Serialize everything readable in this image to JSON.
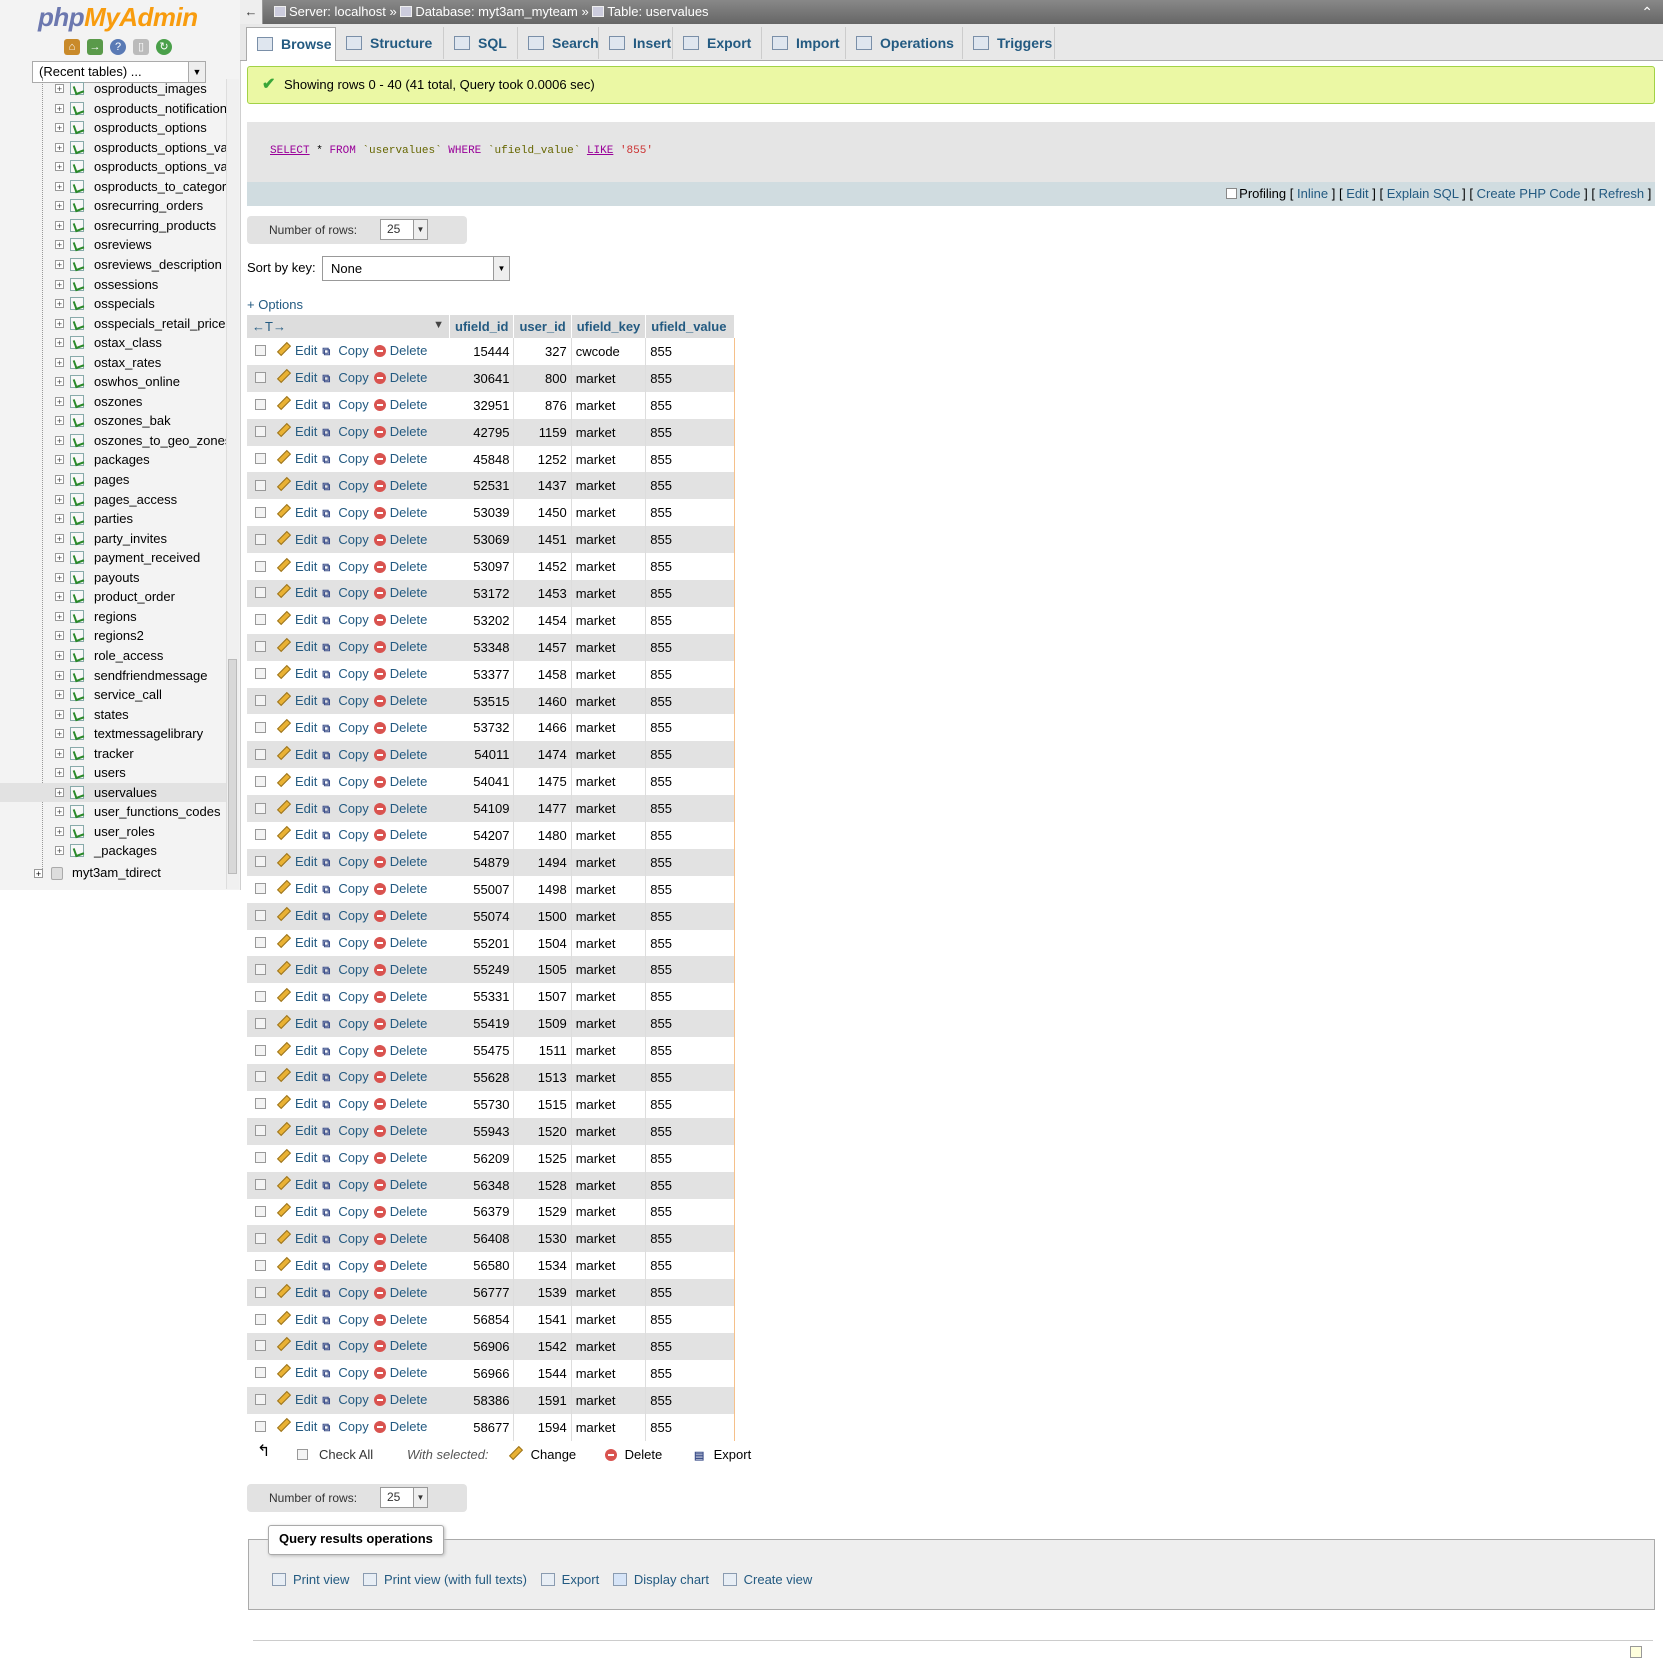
{
  "logo": {
    "php": "php",
    "myadmin": "MyAdmin"
  },
  "nav_icons": [
    "home-icon",
    "logout-icon",
    "help-icon",
    "docs-icon",
    "reload-icon"
  ],
  "recent_tables": {
    "value": "(Recent tables) ..."
  },
  "tree": {
    "tables": [
      "osproducts_images",
      "osproducts_notifications",
      "osproducts_options",
      "osproducts_options_values",
      "osproducts_options_values_to",
      "osproducts_to_categories",
      "osrecurring_orders",
      "osrecurring_products",
      "osreviews",
      "osreviews_description",
      "ossessions",
      "osspecials",
      "osspecials_retail_prices",
      "ostax_class",
      "ostax_rates",
      "oswhos_online",
      "oszones",
      "oszones_bak",
      "oszones_to_geo_zones",
      "packages",
      "pages",
      "pages_access",
      "parties",
      "party_invites",
      "payment_received",
      "payouts",
      "product_order",
      "regions",
      "regions2",
      "role_access",
      "sendfriendmessage",
      "service_call",
      "states",
      "textmessagelibrary",
      "tracker",
      "users",
      "uservalues",
      "user_functions_codes",
      "user_roles",
      "_packages"
    ],
    "selected": "uservalues",
    "database": "myt3am_tdirect"
  },
  "breadcrumb": {
    "server": "Server: localhost",
    "sep": "»",
    "database": "Database: myt3am_myteam",
    "table": "Table: uservalues"
  },
  "tabs": [
    "Browse",
    "Structure",
    "SQL",
    "Search",
    "Insert",
    "Export",
    "Import",
    "Operations",
    "Triggers"
  ],
  "active_tab": "Browse",
  "message": "Showing rows 0 - 40 (41 total, Query took 0.0006 sec)",
  "sql": {
    "select": "SELECT",
    "star": "*",
    "from": "FROM",
    "table": "`uservalues`",
    "where": "WHERE",
    "column": "`ufield_value`",
    "like": "LIKE",
    "value": "'855'"
  },
  "sql_links": {
    "profiling": "Profiling",
    "inline": "Inline",
    "edit": "Edit",
    "explain": "Explain SQL",
    "php": "Create PHP Code",
    "refresh": "Refresh",
    "lb": "[",
    "rb": "]"
  },
  "number_of_rows": {
    "label": "Number of rows:",
    "value": "25"
  },
  "sort_by": {
    "label": "Sort by key:",
    "value": "None"
  },
  "options_link": "+ Options",
  "columns": {
    "arrows": "←T→",
    "c1": "ufield_id",
    "c2": "user_id",
    "c3": "ufield_key",
    "c4": "ufield_value"
  },
  "row_actions": {
    "edit": "Edit",
    "copy": "Copy",
    "delete": "Delete"
  },
  "rows": [
    [
      "15444",
      "327",
      "cwcode",
      "855"
    ],
    [
      "30641",
      "800",
      "market",
      "855"
    ],
    [
      "32951",
      "876",
      "market",
      "855"
    ],
    [
      "42795",
      "1159",
      "market",
      "855"
    ],
    [
      "45848",
      "1252",
      "market",
      "855"
    ],
    [
      "52531",
      "1437",
      "market",
      "855"
    ],
    [
      "53039",
      "1450",
      "market",
      "855"
    ],
    [
      "53069",
      "1451",
      "market",
      "855"
    ],
    [
      "53097",
      "1452",
      "market",
      "855"
    ],
    [
      "53172",
      "1453",
      "market",
      "855"
    ],
    [
      "53202",
      "1454",
      "market",
      "855"
    ],
    [
      "53348",
      "1457",
      "market",
      "855"
    ],
    [
      "53377",
      "1458",
      "market",
      "855"
    ],
    [
      "53515",
      "1460",
      "market",
      "855"
    ],
    [
      "53732",
      "1466",
      "market",
      "855"
    ],
    [
      "54011",
      "1474",
      "market",
      "855"
    ],
    [
      "54041",
      "1475",
      "market",
      "855"
    ],
    [
      "54109",
      "1477",
      "market",
      "855"
    ],
    [
      "54207",
      "1480",
      "market",
      "855"
    ],
    [
      "54879",
      "1494",
      "market",
      "855"
    ],
    [
      "55007",
      "1498",
      "market",
      "855"
    ],
    [
      "55074",
      "1500",
      "market",
      "855"
    ],
    [
      "55201",
      "1504",
      "market",
      "855"
    ],
    [
      "55249",
      "1505",
      "market",
      "855"
    ],
    [
      "55331",
      "1507",
      "market",
      "855"
    ],
    [
      "55419",
      "1509",
      "market",
      "855"
    ],
    [
      "55475",
      "1511",
      "market",
      "855"
    ],
    [
      "55628",
      "1513",
      "market",
      "855"
    ],
    [
      "55730",
      "1515",
      "market",
      "855"
    ],
    [
      "55943",
      "1520",
      "market",
      "855"
    ],
    [
      "56209",
      "1525",
      "market",
      "855"
    ],
    [
      "56348",
      "1528",
      "market",
      "855"
    ],
    [
      "56379",
      "1529",
      "market",
      "855"
    ],
    [
      "56408",
      "1530",
      "market",
      "855"
    ],
    [
      "56580",
      "1534",
      "market",
      "855"
    ],
    [
      "56777",
      "1539",
      "market",
      "855"
    ],
    [
      "56854",
      "1541",
      "market",
      "855"
    ],
    [
      "56906",
      "1542",
      "market",
      "855"
    ],
    [
      "56966",
      "1544",
      "market",
      "855"
    ],
    [
      "58386",
      "1591",
      "market",
      "855"
    ],
    [
      "58677",
      "1594",
      "market",
      "855"
    ]
  ],
  "bulk": {
    "check_all": "Check All",
    "with_selected": "With selected:",
    "change": "Change",
    "delete": "Delete",
    "export": "Export"
  },
  "qro": {
    "legend": "Query results operations",
    "print": "Print view",
    "print_full": "Print view (with full texts)",
    "export": "Export",
    "chart": "Display chart",
    "view": "Create view"
  }
}
